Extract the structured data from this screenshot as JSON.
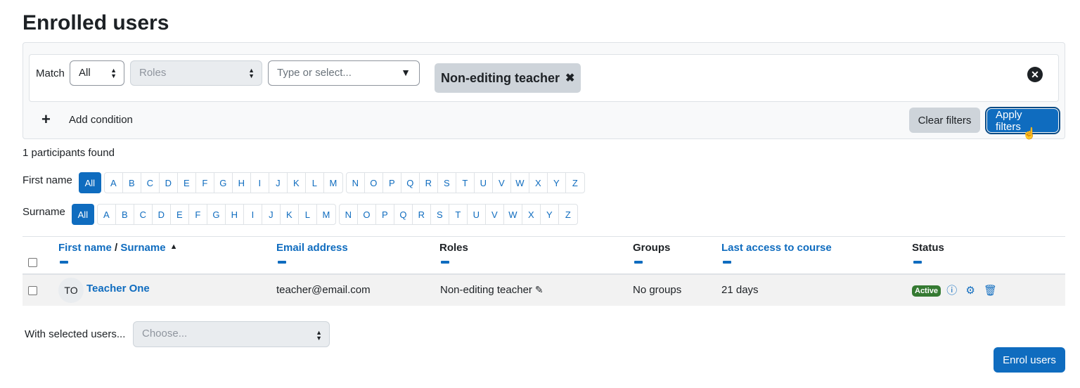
{
  "page": {
    "title": "Enrolled users"
  },
  "filter": {
    "match_label": "Match",
    "match_value": "All",
    "field_value": "Roles",
    "combo_placeholder": "Type or select...",
    "chip_label": "Non-editing teacher",
    "add_condition": "Add condition",
    "clear_label": "Clear filters",
    "apply_label": "Apply filters"
  },
  "summary": {
    "participants": "1 participants found"
  },
  "initials": {
    "first_label": "First name",
    "surname_label": "Surname",
    "all": "All",
    "group1": [
      "A",
      "B",
      "C",
      "D",
      "E",
      "F",
      "G",
      "H",
      "I",
      "J",
      "K",
      "L",
      "M"
    ],
    "group2": [
      "N",
      "O",
      "P",
      "Q",
      "R",
      "S",
      "T",
      "U",
      "V",
      "W",
      "X",
      "Y",
      "Z"
    ]
  },
  "table": {
    "headers": {
      "first_name": "First name",
      "sep": " / ",
      "surname": "Surname",
      "email": "Email address",
      "roles": "Roles",
      "groups": "Groups",
      "last_access": "Last access to course",
      "status": "Status"
    },
    "rows": [
      {
        "initials": "TO",
        "name": "Teacher One",
        "email": "teacher@email.com",
        "role": "Non-editing teacher",
        "groups": "No groups",
        "last_access": "21 days",
        "status": "Active"
      }
    ]
  },
  "bulk": {
    "label": "With selected users...",
    "placeholder": "Choose..."
  },
  "enrol": {
    "label": "Enrol users"
  },
  "colors": {
    "primary": "#0f6cbf",
    "active_badge": "#357a32",
    "chip_bg": "#ced4da"
  }
}
